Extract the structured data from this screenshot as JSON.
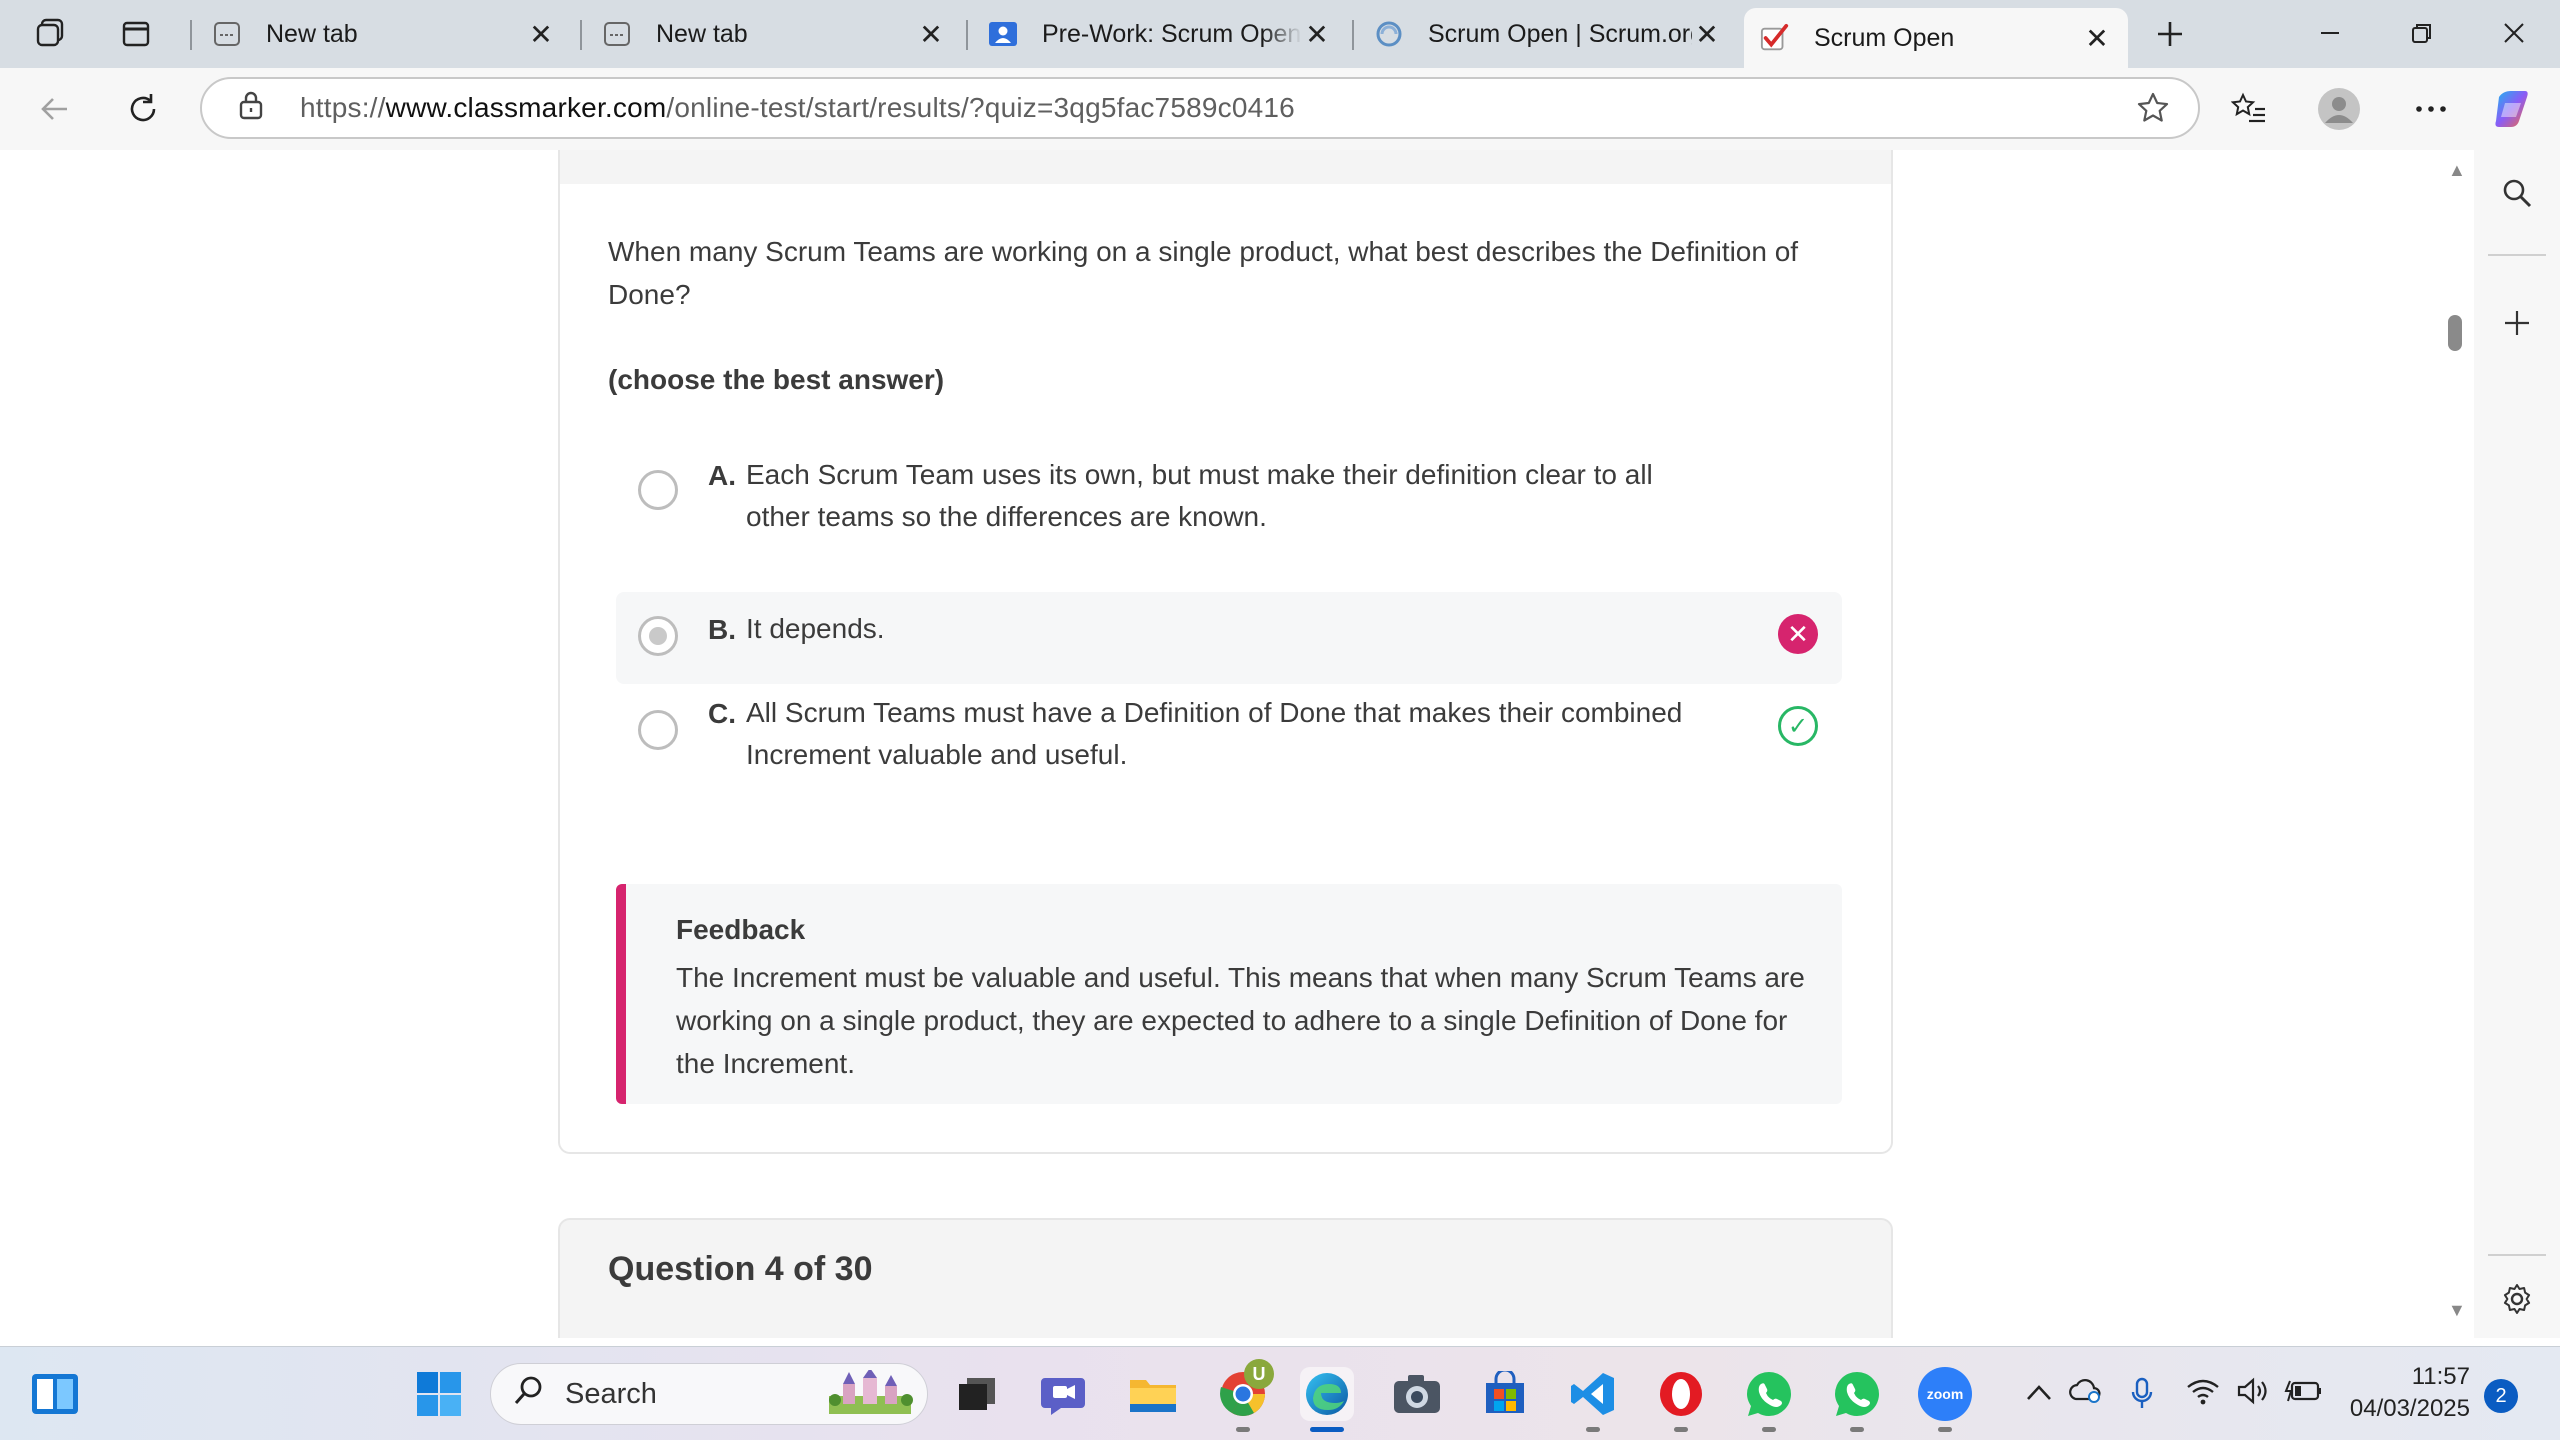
{
  "browser": {
    "tabs": [
      {
        "title": "New tab",
        "favicon": "newtab-icon"
      },
      {
        "title": "New tab",
        "favicon": "newtab-icon"
      },
      {
        "title": "Pre-Work: Scrum Open A",
        "favicon": "contact-card-icon"
      },
      {
        "title": "Scrum Open | Scrum.org",
        "favicon": "scrum-org-icon"
      },
      {
        "title": "Scrum Open",
        "favicon": "checkmark-icon",
        "active": true
      }
    ],
    "url_prefix": "https://",
    "url_host": "www.classmarker.com",
    "url_path": "/online-test/start/results/?quiz=3qg5fac7589c0416"
  },
  "quiz": {
    "question_text": "When many Scrum Teams are working on a single product, what best describes the Definition of Done?",
    "instruction": "(choose the best answer)",
    "options": [
      {
        "letter": "A.",
        "text": "Each Scrum Team uses its own, but must make their definition clear to all other teams so the differences are known."
      },
      {
        "letter": "B.",
        "text": "It depends.",
        "selected": true,
        "result": "wrong"
      },
      {
        "letter": "C.",
        "text": "All Scrum Teams must have a Definition of Done that makes their combined Increment valuable and useful.",
        "result": "correct"
      }
    ],
    "feedback_title": "Feedback",
    "feedback_body": "The Increment must be valuable and useful. This means that when many Scrum Teams are working on a single product, they are expected to adhere to a single Definition of Done for the Increment.",
    "next_question_label": "Question 4 of 30"
  },
  "taskbar": {
    "search_placeholder": "Search",
    "chrome_badge": "U",
    "zoom_label": "zoom",
    "time": "11:57",
    "date": "04/03/2025",
    "notifications": "2"
  },
  "colors": {
    "wrong": "#d6246e",
    "correct": "#28b765",
    "feedback_accent": "#d6246e"
  }
}
